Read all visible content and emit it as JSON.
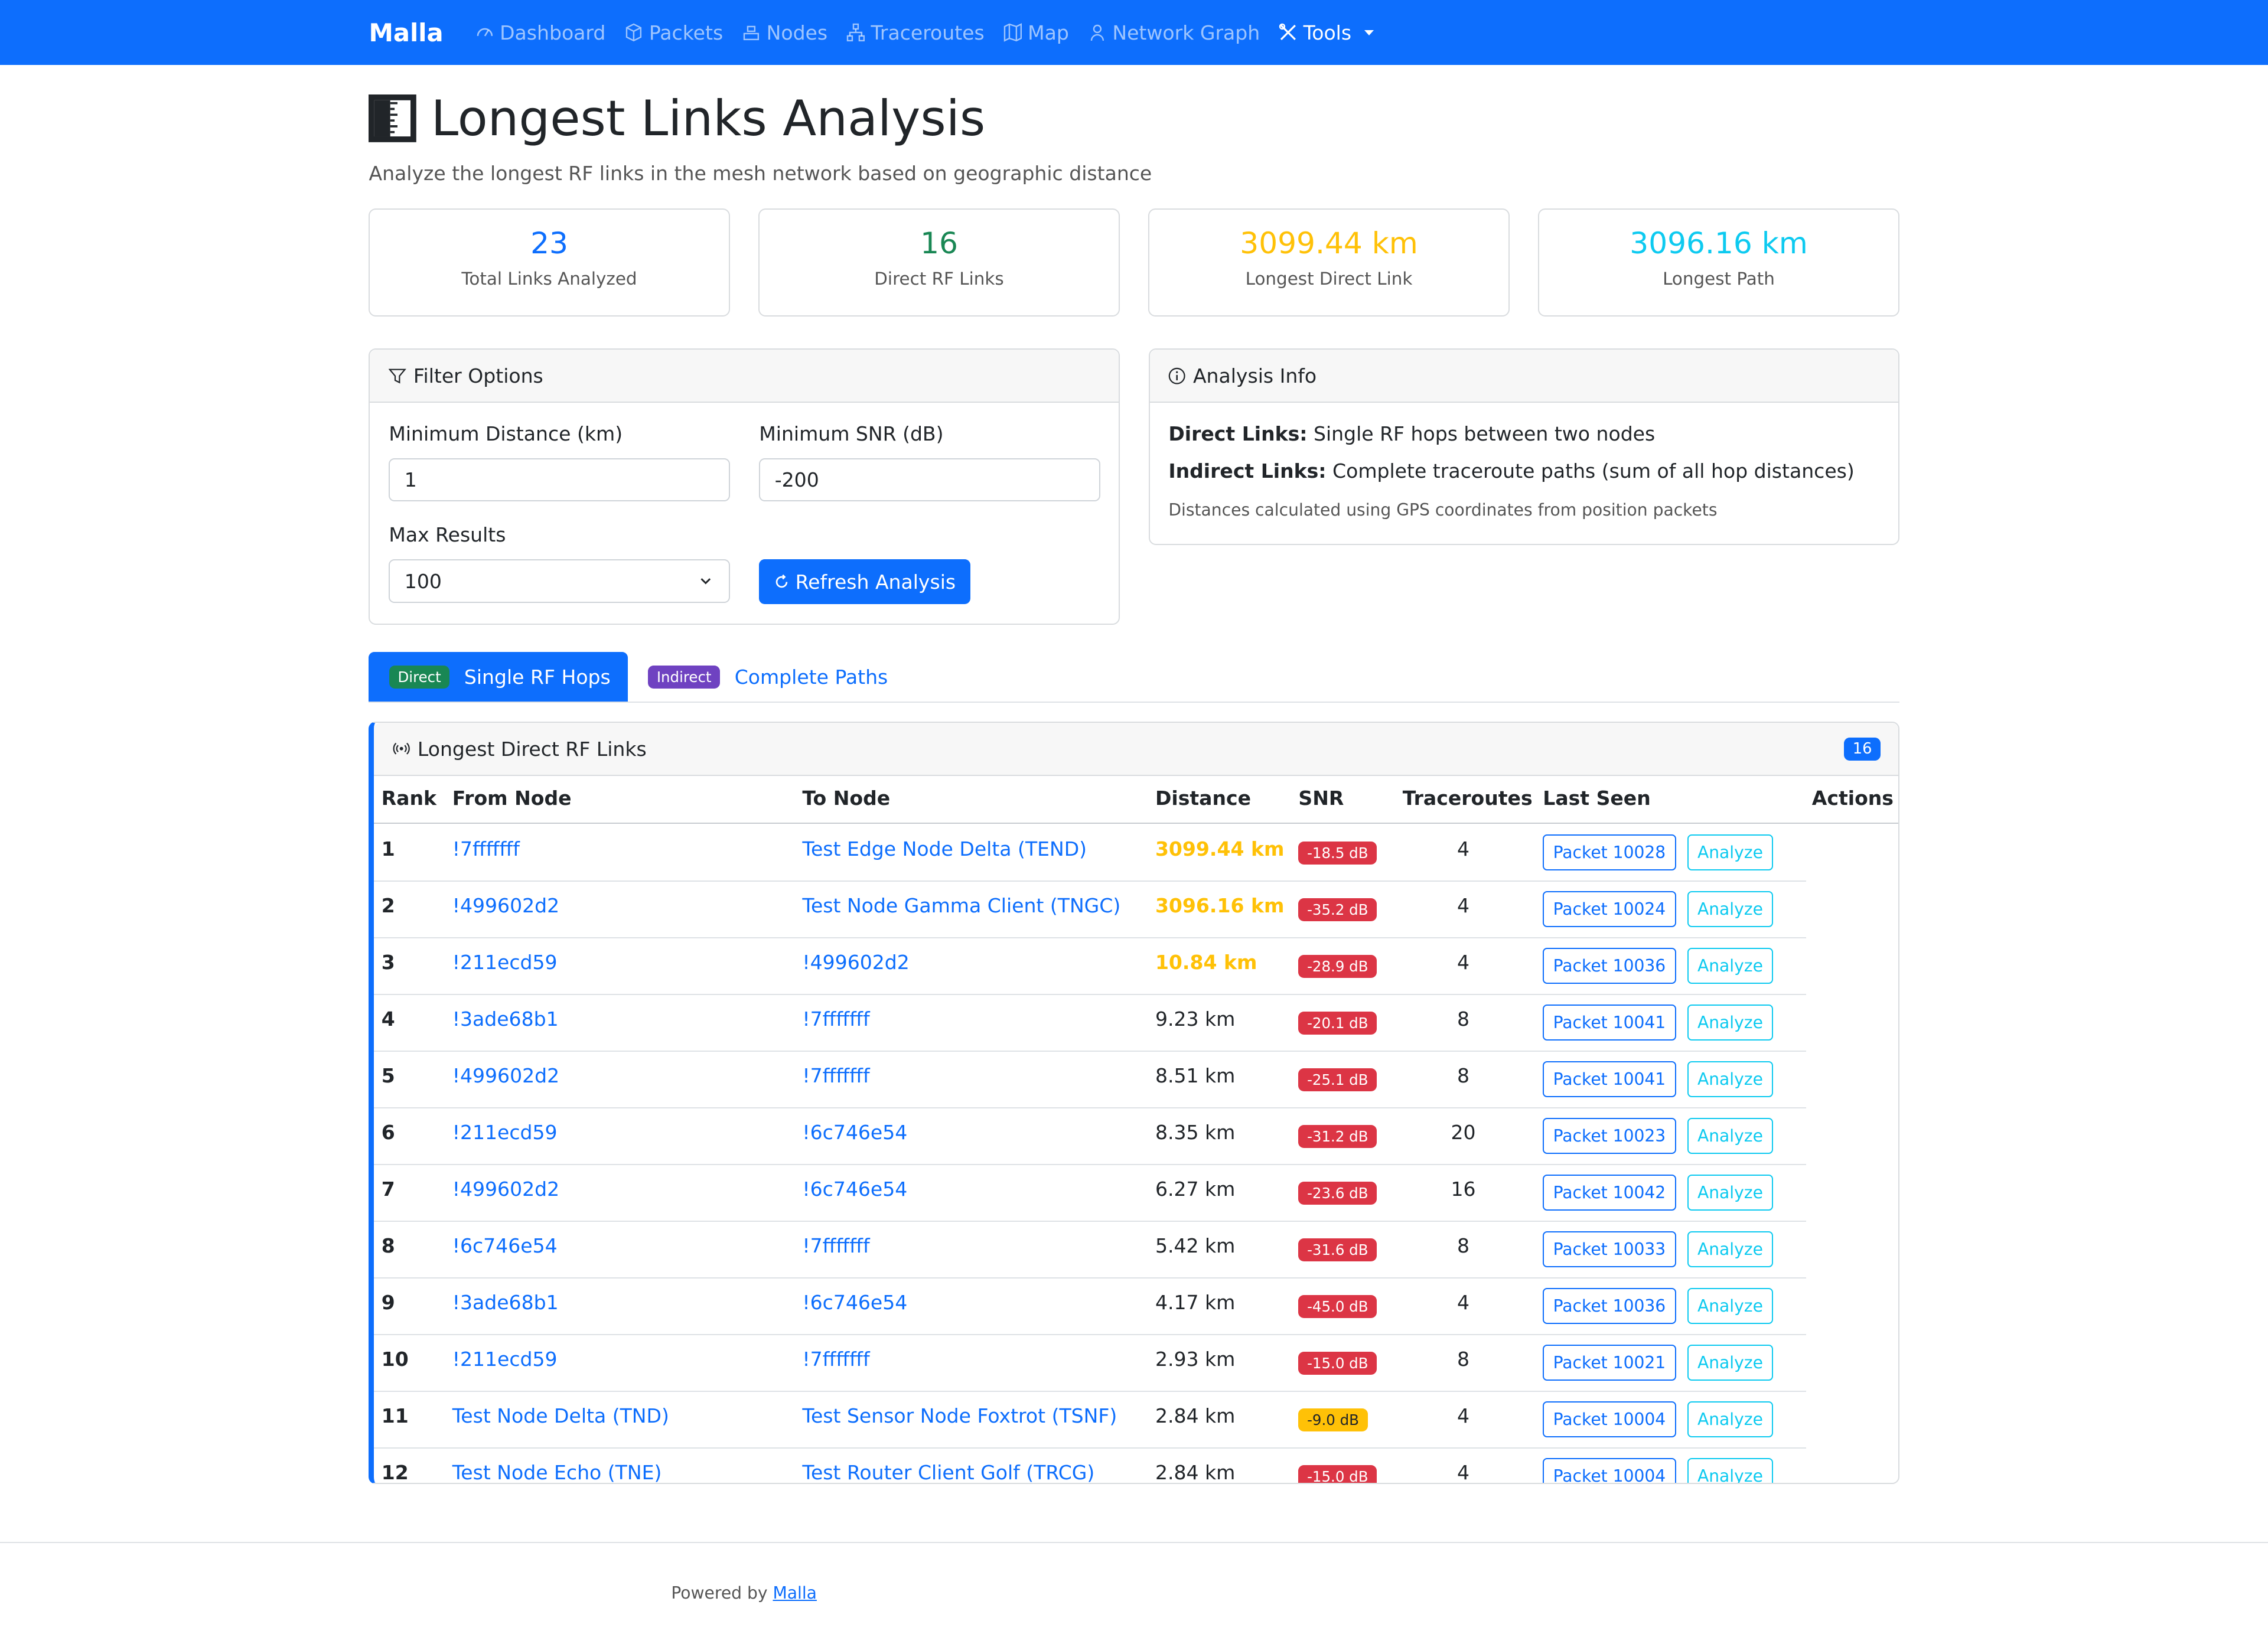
{
  "nav": {
    "brand": "Malla",
    "items": [
      {
        "label": "Dashboard",
        "icon": "dashboard-icon"
      },
      {
        "label": "Packets",
        "icon": "box-icon"
      },
      {
        "label": "Nodes",
        "icon": "nodes-icon"
      },
      {
        "label": "Traceroutes",
        "icon": "diagram-icon"
      },
      {
        "label": "Map",
        "icon": "map-icon"
      },
      {
        "label": "Network Graph",
        "icon": "person-icon"
      },
      {
        "label": "Tools",
        "icon": "tools-icon"
      }
    ]
  },
  "page": {
    "title": "Longest Links Analysis",
    "subtitle": "Analyze the longest RF links in the mesh network based on geographic distance"
  },
  "stats": [
    {
      "value": "23",
      "label": "Total Links Analyzed",
      "color": "#0d6efd"
    },
    {
      "value": "16",
      "label": "Direct RF Links",
      "color": "#198754"
    },
    {
      "value": "3099.44 km",
      "label": "Longest Direct Link",
      "color": "#ffc107"
    },
    {
      "value": "3096.16 km",
      "label": "Longest Path",
      "color": "#0dcaf0"
    }
  ],
  "filter": {
    "title": "Filter Options",
    "min_distance_label": "Minimum Distance (km)",
    "min_distance_value": "1",
    "min_snr_label": "Minimum SNR (dB)",
    "min_snr_value": "-200",
    "max_results_label": "Max Results",
    "max_results_value": "100",
    "refresh_label": "Refresh Analysis"
  },
  "info": {
    "title": "Analysis Info",
    "direct_label": "Direct Links:",
    "direct_text": "Single RF hops between two nodes",
    "indirect_label": "Indirect Links:",
    "indirect_text": "Complete traceroute paths (sum of all hop distances)",
    "note": "Distances calculated using GPS coordinates from position packets"
  },
  "tabs": {
    "direct_badge": "Direct",
    "direct_label": "Single RF Hops",
    "indirect_badge": "Indirect",
    "indirect_label": "Complete Paths"
  },
  "table": {
    "title": "Longest Direct RF Links",
    "count": "16",
    "headers": [
      "Rank",
      "From Node",
      "To Node",
      "Distance",
      "SNR",
      "Traceroutes",
      "Last Seen",
      "Actions"
    ],
    "analyze_label": "Analyze",
    "rows": [
      {
        "rank": "1",
        "from": "!7fffffff",
        "to": "Test Edge Node Delta (TEND)",
        "distance": "3099.44 km",
        "highlight": true,
        "snr": "-18.5 dB",
        "snr_type": "danger",
        "traceroutes": "4",
        "packet": "Packet 10028"
      },
      {
        "rank": "2",
        "from": "!499602d2",
        "to": "Test Node Gamma Client (TNGC)",
        "distance": "3096.16 km",
        "highlight": true,
        "snr": "-35.2 dB",
        "snr_type": "danger",
        "traceroutes": "4",
        "packet": "Packet 10024"
      },
      {
        "rank": "3",
        "from": "!211ecd59",
        "to": "!499602d2",
        "distance": "10.84 km",
        "highlight": true,
        "snr": "-28.9 dB",
        "snr_type": "danger",
        "traceroutes": "4",
        "packet": "Packet 10036"
      },
      {
        "rank": "4",
        "from": "!3ade68b1",
        "to": "!7fffffff",
        "distance": "9.23 km",
        "highlight": false,
        "snr": "-20.1 dB",
        "snr_type": "danger",
        "traceroutes": "8",
        "packet": "Packet 10041"
      },
      {
        "rank": "5",
        "from": "!499602d2",
        "to": "!7fffffff",
        "distance": "8.51 km",
        "highlight": false,
        "snr": "-25.1 dB",
        "snr_type": "danger",
        "traceroutes": "8",
        "packet": "Packet 10041"
      },
      {
        "rank": "6",
        "from": "!211ecd59",
        "to": "!6c746e54",
        "distance": "8.35 km",
        "highlight": false,
        "snr": "-31.2 dB",
        "snr_type": "danger",
        "traceroutes": "20",
        "packet": "Packet 10023"
      },
      {
        "rank": "7",
        "from": "!499602d2",
        "to": "!6c746e54",
        "distance": "6.27 km",
        "highlight": false,
        "snr": "-23.6 dB",
        "snr_type": "danger",
        "traceroutes": "16",
        "packet": "Packet 10042"
      },
      {
        "rank": "8",
        "from": "!6c746e54",
        "to": "!7fffffff",
        "distance": "5.42 km",
        "highlight": false,
        "snr": "-31.6 dB",
        "snr_type": "danger",
        "traceroutes": "8",
        "packet": "Packet 10033"
      },
      {
        "rank": "9",
        "from": "!3ade68b1",
        "to": "!6c746e54",
        "distance": "4.17 km",
        "highlight": false,
        "snr": "-45.0 dB",
        "snr_type": "danger",
        "traceroutes": "4",
        "packet": "Packet 10036"
      },
      {
        "rank": "10",
        "from": "!211ecd59",
        "to": "!7fffffff",
        "distance": "2.93 km",
        "highlight": false,
        "snr": "-15.0 dB",
        "snr_type": "danger",
        "traceroutes": "8",
        "packet": "Packet 10021"
      },
      {
        "rank": "11",
        "from": "Test Node Delta (TND)",
        "to": "Test Sensor Node Foxtrot (TSNF)",
        "distance": "2.84 km",
        "highlight": false,
        "snr": "-9.0 dB",
        "snr_type": "warning",
        "traceroutes": "4",
        "packet": "Packet 10004"
      },
      {
        "rank": "12",
        "from": "Test Node Echo (TNE)",
        "to": "Test Router Client Golf (TRCG)",
        "distance": "2.84 km",
        "highlight": false,
        "snr": "-15.0 dB",
        "snr_type": "danger",
        "traceroutes": "4",
        "packet": "Packet 10004"
      }
    ]
  },
  "footer": {
    "prefix": "Powered by",
    "link": "Malla"
  }
}
